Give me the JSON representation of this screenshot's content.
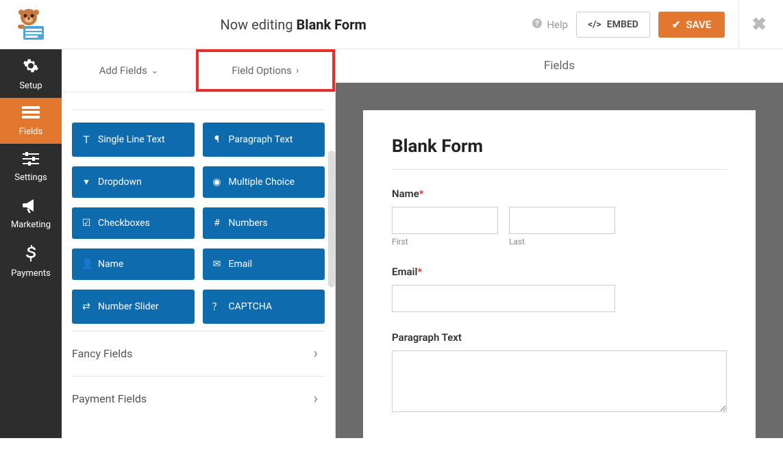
{
  "header": {
    "editing_prefix": "Now editing ",
    "form_name": "Blank Form",
    "help": "Help",
    "embed": "EMBED",
    "save": "SAVE"
  },
  "nav": [
    {
      "id": "setup",
      "label": "Setup",
      "icon": "gear"
    },
    {
      "id": "fields",
      "label": "Fields",
      "icon": "list",
      "active": true
    },
    {
      "id": "settings",
      "label": "Settings",
      "icon": "sliders"
    },
    {
      "id": "marketing",
      "label": "Marketing",
      "icon": "bullhorn"
    },
    {
      "id": "payments",
      "label": "Payments",
      "icon": "dollar"
    }
  ],
  "left": {
    "section_title": "Fields",
    "tabs": {
      "add": "Add Fields",
      "options": "Field Options"
    },
    "standard_fields": [
      {
        "label": "Single Line Text",
        "icon": "text"
      },
      {
        "label": "Paragraph Text",
        "icon": "paragraph"
      },
      {
        "label": "Dropdown",
        "icon": "caret-down-sq"
      },
      {
        "label": "Multiple Choice",
        "icon": "dot-circle"
      },
      {
        "label": "Checkboxes",
        "icon": "check-square"
      },
      {
        "label": "Numbers",
        "icon": "hash"
      },
      {
        "label": "Name",
        "icon": "user"
      },
      {
        "label": "Email",
        "icon": "envelope"
      },
      {
        "label": "Number Slider",
        "icon": "slider"
      },
      {
        "label": "CAPTCHA",
        "icon": "question-circle"
      }
    ],
    "groups": [
      {
        "label": "Fancy Fields"
      },
      {
        "label": "Payment Fields"
      }
    ]
  },
  "preview": {
    "section_title": "Fields",
    "form_title": "Blank Form",
    "name": {
      "label": "Name",
      "required": true,
      "first": "First",
      "last": "Last"
    },
    "email": {
      "label": "Email",
      "required": true
    },
    "paragraph": {
      "label": "Paragraph Text"
    }
  }
}
